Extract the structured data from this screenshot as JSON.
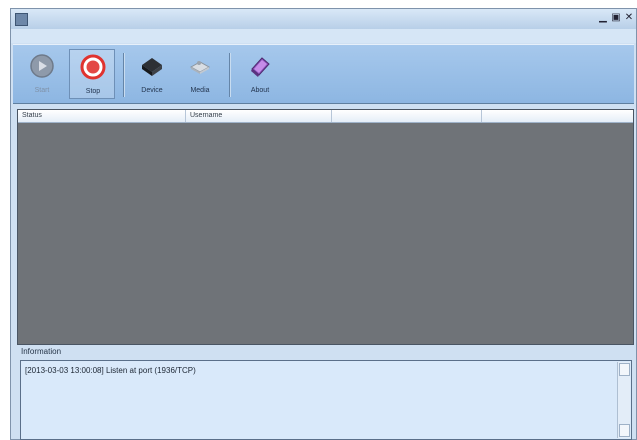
{
  "window": {
    "title": "",
    "controls": {
      "minimize": "▁",
      "maximize": "▣",
      "close": "✕"
    }
  },
  "menu": {
    "items": [
      "",
      "",
      "",
      ""
    ]
  },
  "toolbar": {
    "buttons": [
      {
        "label": "Start",
        "icon": "play-circle-icon",
        "enabled": false
      },
      {
        "label": "Stop",
        "icon": "stop-circle-icon",
        "enabled": true,
        "active": true
      },
      {
        "label": "Device",
        "icon": "device-icon",
        "enabled": true
      },
      {
        "label": "Media",
        "icon": "media-icon",
        "enabled": true
      },
      {
        "label": "About",
        "icon": "about-icon",
        "enabled": true
      }
    ]
  },
  "list": {
    "columns": [
      "Status",
      "Username",
      "",
      ""
    ]
  },
  "information": {
    "label": "Information",
    "log": [
      "[2013-03-03 13:00:08] Listen at port (1936/TCP)"
    ]
  },
  "colors": {
    "toolbar": "#9fc3ea",
    "list_background": "#6f7378",
    "info_background": "#d9e9fa"
  }
}
